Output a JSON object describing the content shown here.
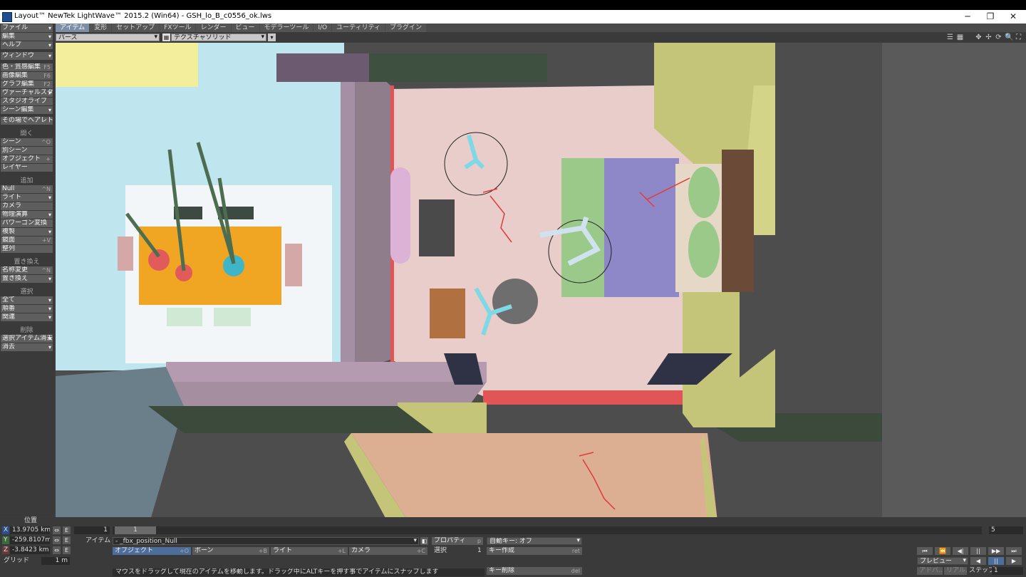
{
  "window": {
    "title": "Layout™ NewTek LightWave™ 2015.2 (Win64) - GSH_lo_B_c0556_ok.lws",
    "controls": [
      "─",
      "❐",
      "✕"
    ]
  },
  "tabs": [
    {
      "label": "アイテム",
      "active": true
    },
    {
      "label": "変形",
      "active": false
    },
    {
      "label": "セットアップ",
      "active": false
    },
    {
      "label": "FXツール",
      "active": false
    },
    {
      "label": "レンダー",
      "active": false
    },
    {
      "label": "ビュー",
      "active": false
    },
    {
      "label": "モデラーツール",
      "active": false
    },
    {
      "label": "I/O",
      "active": false
    },
    {
      "label": "ユーティリティ",
      "active": false
    },
    {
      "label": "プラグイン",
      "active": false
    }
  ],
  "viewbar": {
    "view_mode": "パース",
    "render_mode": "テクスチャソリッド"
  },
  "sidebar": {
    "menus": [
      {
        "label": "ファイル"
      },
      {
        "label": "編集"
      },
      {
        "label": "ヘルプ"
      },
      {
        "label": "ウィンドウ"
      }
    ],
    "tools": [
      {
        "label": "色・質感編集",
        "key": "F5"
      },
      {
        "label": "画像編集",
        "key": "F6"
      },
      {
        "label": "グラフ編集",
        "key": "F2"
      },
      {
        "label": "ヴァーチャルスタジオ",
        "key": ""
      },
      {
        "label": "スタジオライブ",
        "key": ""
      },
      {
        "label": "シーン編集",
        "key": ""
      },
      {
        "label": "その場でヘアレト",
        "key": ""
      }
    ],
    "open_header": "開く",
    "open_items": [
      {
        "label": "シーン",
        "key": "^O"
      },
      {
        "label": "別シーン",
        "key": ""
      },
      {
        "label": "オブジェクト",
        "key": "+"
      },
      {
        "label": "レイヤー",
        "key": ""
      }
    ],
    "add_header": "追加",
    "add_items": [
      {
        "label": "Null",
        "key": "^N"
      },
      {
        "label": "ライト",
        "key": ""
      },
      {
        "label": "カメラ",
        "key": ""
      },
      {
        "label": "物理演算",
        "key": ""
      },
      {
        "label": "パワーゴン変換",
        "key": ""
      },
      {
        "label": "複製",
        "key": ""
      },
      {
        "label": "鏡面",
        "key": "+V"
      },
      {
        "label": "整列",
        "key": ""
      }
    ],
    "replace_header": "置き換え",
    "replace_items": [
      {
        "label": "名称変更",
        "key": "^N"
      },
      {
        "label": "置き換え",
        "key": ""
      }
    ],
    "select_header": "選択",
    "select_items": [
      {
        "label": "全て"
      },
      {
        "label": "順番"
      },
      {
        "label": "関連"
      }
    ],
    "delete_header": "削除",
    "delete_items": [
      {
        "label": "選択アイテム消去"
      },
      {
        "label": "消去"
      }
    ]
  },
  "position": {
    "title": "位置",
    "x_label": "X",
    "x_value": "13.9705 km",
    "y_label": "Y",
    "y_value": "-259.8107m",
    "z_label": "Z",
    "z_value": "-3.8423 km",
    "grid_label": "グリッド",
    "grid_value": "1 m",
    "e_label": "E"
  },
  "timeline": {
    "start_frame": "1",
    "current_frame": "1",
    "end_frame": "5"
  },
  "item_row": {
    "label": "アイテム",
    "current_item": "- _fbx_position_Null",
    "properties": "プロパティ",
    "properties_key": "p",
    "autokey": "自動キー: オフ"
  },
  "type_buttons": [
    {
      "label": "オブジェクト",
      "key": "+O",
      "active": true
    },
    {
      "label": "ボーン",
      "key": "+B",
      "active": false
    },
    {
      "label": "ライト",
      "key": "+L",
      "active": false
    },
    {
      "label": "カメラ",
      "key": "+C",
      "active": false
    }
  ],
  "selection": {
    "label": "選択",
    "count": "1"
  },
  "keys": {
    "create": "キー作成",
    "create_key": "ret",
    "delete": "キー削除",
    "delete_key": "del"
  },
  "status": "マウスをドラッグして現在のアイテムを移動します。ドラッグ中にALTキーを押す事でアイテムにスナップします",
  "playback": {
    "transport": [
      "⏮",
      "⏪",
      "◀|",
      "||",
      "▶▶",
      "⏭"
    ],
    "preview": "プレビュー",
    "buttons": [
      "◀",
      "||",
      "▶"
    ],
    "bottom_labels": [
      "アドバ...",
      "リアル...",
      "ステップ"
    ],
    "step": "1"
  },
  "viewport": {
    "floor_color": "#e8cdca",
    "wall_color": "#b59bb0",
    "table_color": "#f0a623",
    "bed_blanket": "#8f88c8",
    "bed_sheet": "#9bc98a",
    "cabinet_color": "#c5c57a"
  }
}
